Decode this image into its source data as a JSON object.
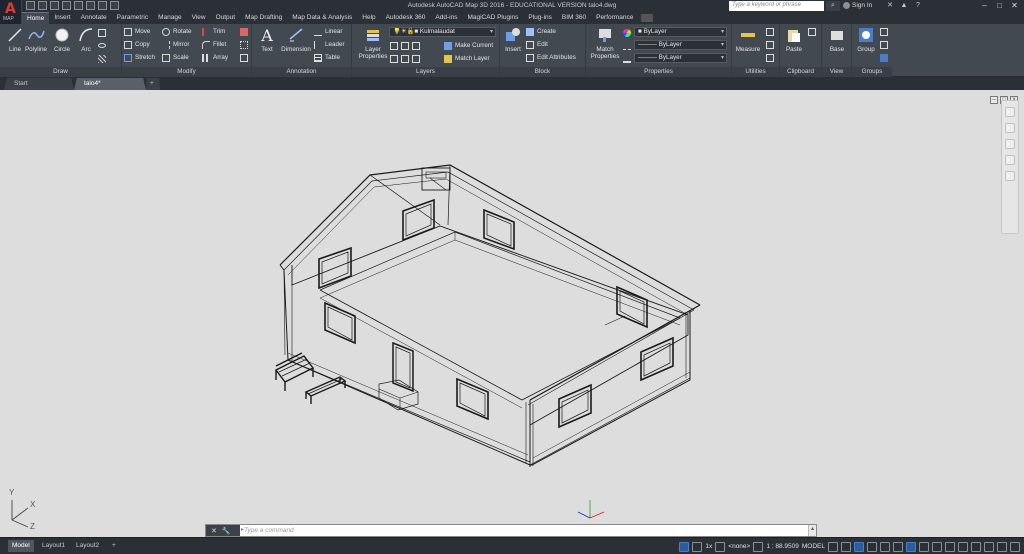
{
  "app": {
    "logo_letter": "A",
    "logo_tag": "MAP",
    "window_title": "Autodesk AutoCAD Map 3D 2016 - EDUCATIONAL VERSION    talo4.dwg",
    "search_placeholder": "Type a keyword or phrase",
    "sign_in": "Sign In"
  },
  "tabs": [
    "Home",
    "Insert",
    "Annotate",
    "Parametric",
    "Manage",
    "View",
    "Output",
    "Map Drafting",
    "Map Data & Analysis",
    "Help",
    "Autodesk 360",
    "Add-ins",
    "MagiCAD Plugins",
    "Plug-ins",
    "BIM 360",
    "Performance"
  ],
  "active_tab": "Home",
  "ribbon": {
    "draw": {
      "title": "Draw",
      "line": "Line",
      "polyline": "Polyline",
      "circle": "Circle",
      "arc": "Arc"
    },
    "modify": {
      "title": "Modify",
      "move": "Move",
      "rotate": "Rotate",
      "trim": "Trim",
      "copy": "Copy",
      "mirror": "Mirror",
      "fillet": "Fillet",
      "stretch": "Stretch",
      "scale": "Scale",
      "array": "Array"
    },
    "annotation": {
      "title": "Annotation",
      "text": "Text",
      "dimension": "Dimension",
      "linear": "Linear",
      "leader": "Leader",
      "table": "Table"
    },
    "layers": {
      "title": "Layers",
      "layer_properties": "Layer Properties",
      "current_layer": "Kulmalaudat",
      "make_current": "Make Current",
      "match_layer": "Match Layer"
    },
    "block": {
      "title": "Block",
      "insert": "Insert",
      "create": "Create",
      "edit": "Edit",
      "edit_attributes": "Edit Attributes"
    },
    "properties": {
      "title": "Properties",
      "match_properties": "Match Properties",
      "color": "ByLayer",
      "linetype": "ByLayer",
      "lineweight": "ByLayer"
    },
    "utilities": {
      "title": "Utilities",
      "measure": "Measure"
    },
    "clipboard": {
      "title": "Clipboard",
      "paste": "Paste"
    },
    "view": {
      "title": "View",
      "base": "Base"
    },
    "groups": {
      "title": "Groups",
      "group": "Group"
    }
  },
  "file_tabs": [
    "Start",
    "talo4*"
  ],
  "active_file_tab": "talo4*",
  "command": {
    "placeholder": "Type a command"
  },
  "ucs": {
    "x": "X",
    "y": "Y",
    "z": "Z"
  },
  "layout_tabs": [
    "Model",
    "Layout1",
    "Layout2"
  ],
  "status": {
    "scale_factor": "1x",
    "none_label": "<none>",
    "scale": "1 : 88.9509",
    "space": "MODEL"
  }
}
